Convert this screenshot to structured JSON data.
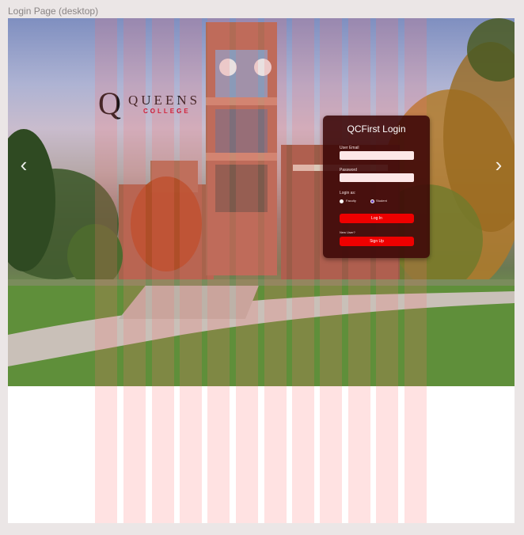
{
  "frame": {
    "label": "Login Page (desktop)"
  },
  "logo": {
    "letter": "Q",
    "name": "QUEENS",
    "sub": "COLLEGE"
  },
  "carousel": {
    "prev_icon": "‹",
    "next_icon": "›"
  },
  "login": {
    "title": "QCFirst Login",
    "email_label": "User Email",
    "email_value": "",
    "password_label": "Password",
    "password_value": "",
    "login_as_label": "Login as:",
    "role_faculty": "Faculty",
    "role_student": "Student",
    "selected_role": "Student",
    "login_button": "Log In",
    "new_user_label": "New User?",
    "signup_button": "Sign Up"
  },
  "colors": {
    "accent": "#ee0000",
    "card": "#3a0606",
    "grid_overlay": "#ff6e6e",
    "radio_selected": "#6a3cc2"
  }
}
